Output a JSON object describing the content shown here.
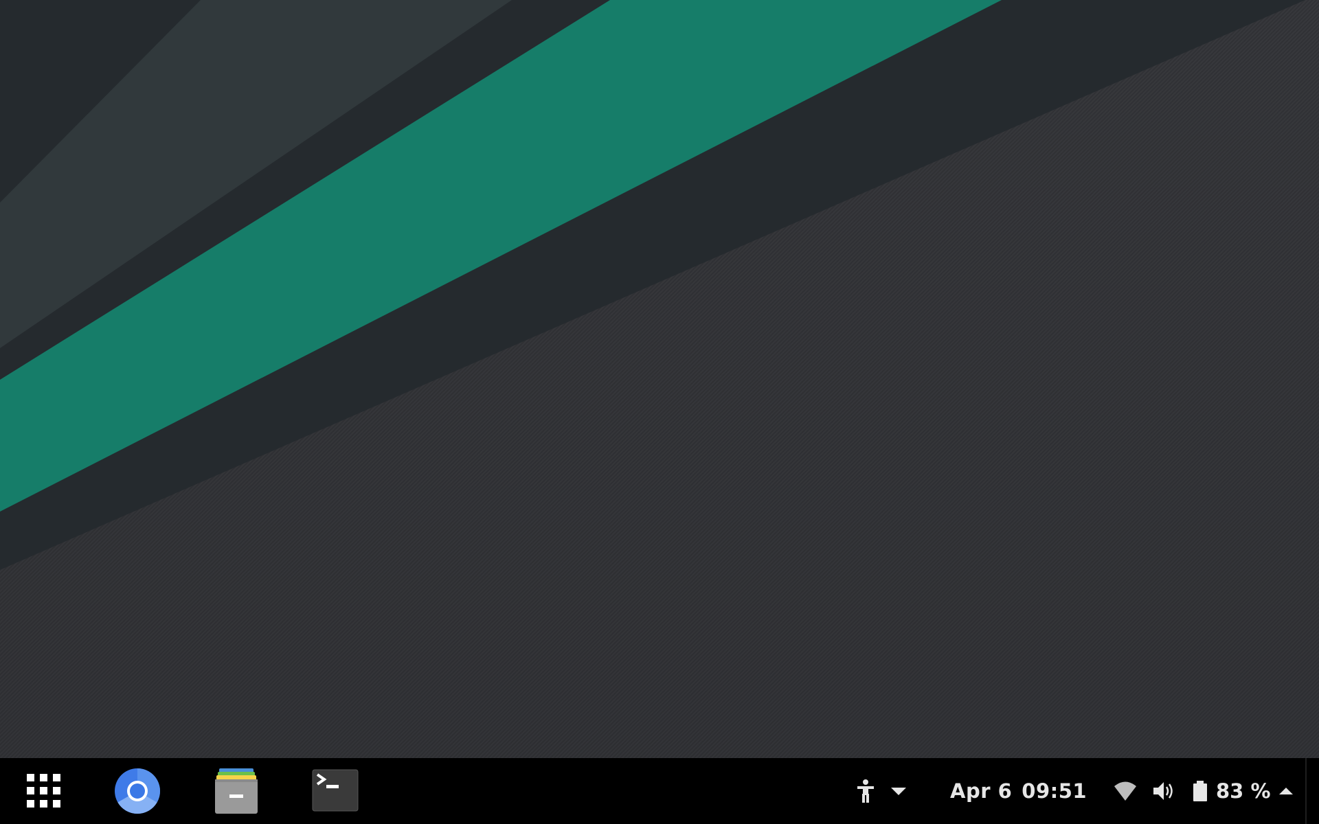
{
  "wallpaper": {
    "colors": {
      "background": "#252a2e",
      "stripe_light": "#31393c",
      "stripe_green": "#167d69",
      "stripe_dark": "#242a2e",
      "texture_base": "#333438"
    }
  },
  "taskbar": {
    "background": "#000000",
    "launchers": [
      {
        "name": "app-grid-icon",
        "label": "Show Applications"
      },
      {
        "name": "chromium-icon",
        "label": "Chromium"
      },
      {
        "name": "files-icon",
        "label": "Files"
      },
      {
        "name": "terminal-icon",
        "label": "Terminal"
      }
    ],
    "tray": {
      "accessibility_icon": "accessibility-icon",
      "dropdown_icon": "triangle-down-icon",
      "date": "Apr 6",
      "time": "09:51",
      "wifi_icon": "wifi-icon",
      "volume_icon": "speaker-icon",
      "battery_icon": "battery-icon",
      "battery_percent": "83 %",
      "menu_icon": "triangle-up-icon"
    }
  }
}
